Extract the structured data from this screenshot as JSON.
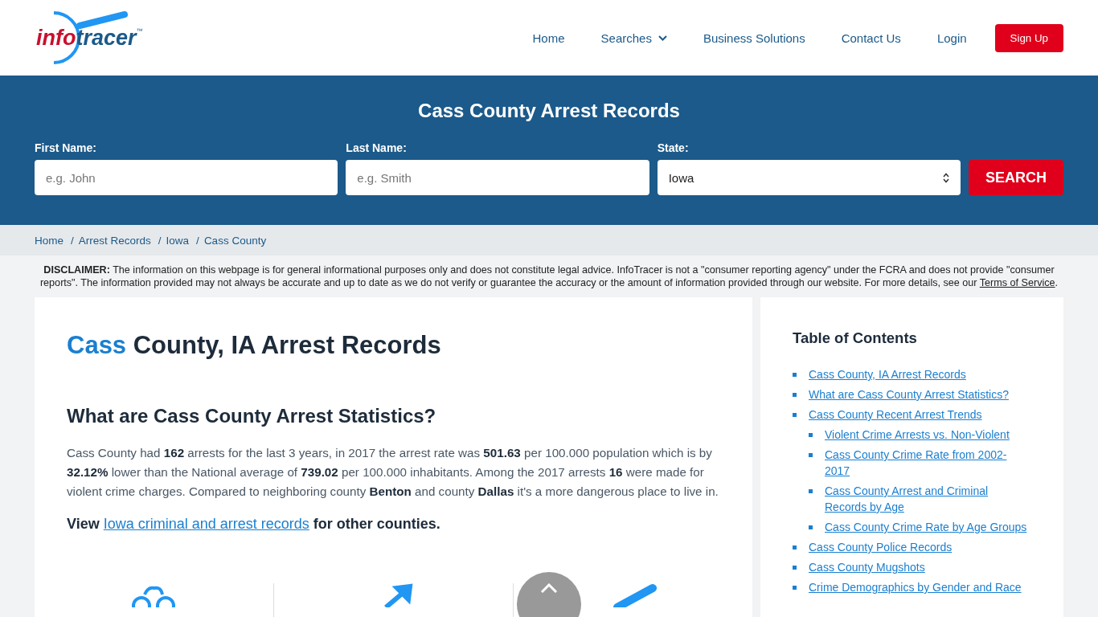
{
  "header": {
    "logo": {
      "part_1": "info",
      "part_2": "tracer",
      "mark": "™"
    },
    "nav": [
      {
        "label": "Home",
        "kind": "link"
      },
      {
        "label": "Searches",
        "kind": "dropdown"
      },
      {
        "label": "Business Solutions",
        "kind": "link"
      },
      {
        "label": "Contact Us",
        "kind": "link"
      },
      {
        "label": "Login",
        "kind": "link"
      },
      {
        "label": "Sign Up",
        "kind": "button"
      }
    ]
  },
  "search": {
    "title": "Cass County Arrest Records",
    "fields": [
      {
        "label": "First Name:",
        "kind": "text",
        "placeholder": "e.g. John"
      },
      {
        "label": "Last Name:",
        "kind": "text",
        "placeholder": "e.g. Smith"
      },
      {
        "label": "State:",
        "kind": "select",
        "value": "Iowa"
      }
    ],
    "button": "SEARCH"
  },
  "breadcrumb": {
    "separator": "/",
    "items": [
      "Home",
      "Arrest Records",
      "Iowa",
      "Cass County"
    ]
  },
  "disclaimer": {
    "text": "**DISCLAIMER:** The information on this webpage is for general informational purposes only and does not constitute legal advice. InfoTracer is not a \"consumer reporting agency\" under the FCRA and does not provide \"consumer reports\". The information provided may not always be accurate and up to date as we do not verify or guarantee the accuracy or the amount of information provided through our website. For more details, see our",
    "link": "Terms of Service",
    "suffix": "."
  },
  "article": {
    "title_highlight": "Cass",
    "title_rest": "County, IA Arrest Records",
    "section_title": "What are Cass County Arrest Statistics?",
    "paragraph": "Cass County had **162** arrests for the last 3 years, in 2017 the arrest rate was **501.63** per 100.000 population which is by **32.12%** lower than the National average of **739.02** per 100.000 inhabitants. Among the 2017 arrests **16** were made for violent crime charges. Compared to neighboring county **Benton** and county **Dallas** it's a more dangerous place to live in.",
    "view": {
      "prefix": "View",
      "link": "Iowa criminal and arrest records",
      "suffix": "for other counties."
    }
  },
  "toc": {
    "title": "Table of Contents",
    "items": [
      {
        "label": "Cass County, IA Arrest Records"
      },
      {
        "label": "What are Cass County Arrest Statistics?"
      },
      {
        "label": "Cass County Recent Arrest Trends",
        "children": [
          {
            "label": "Violent Crime Arrests vs. Non-Violent"
          },
          {
            "label": "Cass County Crime Rate from 2002-2017"
          },
          {
            "label": "Cass County Arrest and Criminal Records by Age"
          },
          {
            "label": "Cass County Crime Rate by Age Groups"
          }
        ]
      },
      {
        "label": "Cass County Police Records"
      },
      {
        "label": "Cass County Mugshots"
      },
      {
        "label": "Crime Demographics by Gender and Race"
      }
    ]
  }
}
